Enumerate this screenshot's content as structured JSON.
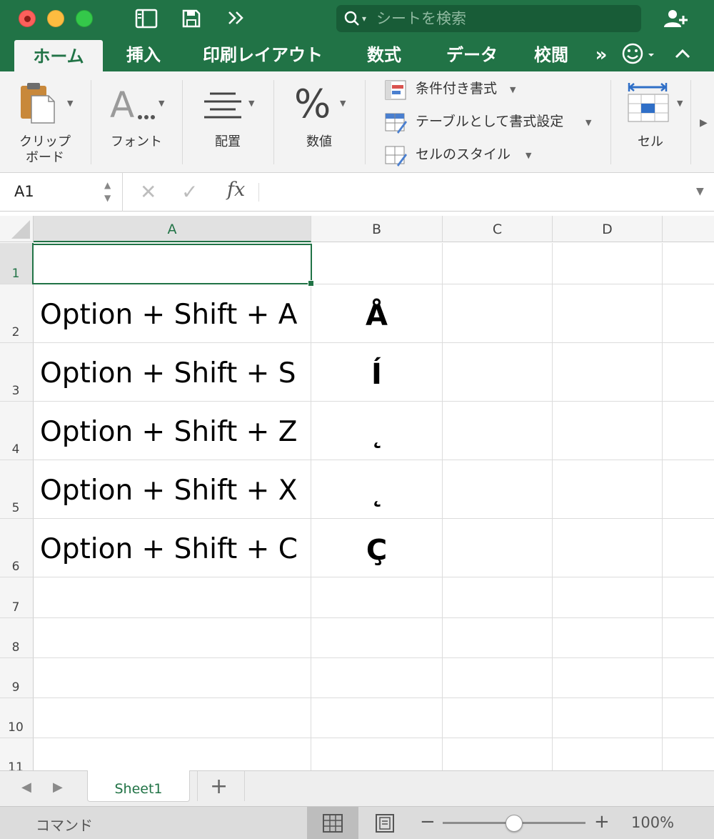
{
  "titlebar": {
    "search_placeholder": "シートを検索"
  },
  "ribbon_tabs": [
    {
      "label": "ホーム",
      "active": true
    },
    {
      "label": "挿入"
    },
    {
      "label": "印刷レイアウト"
    },
    {
      "label": "数式"
    },
    {
      "label": "データ"
    },
    {
      "label": "校閲"
    }
  ],
  "ribbon_tabs_overflow": "»",
  "ribbon": {
    "clipboard_line1": "クリップ",
    "clipboard_line2": "ボード",
    "font": "フォント",
    "alignment": "配置",
    "number": "数値",
    "number_symbol": "%",
    "conditional_formatting": "条件付き書式",
    "format_as_table": "テーブルとして書式設定",
    "cell_styles": "セルのスタイル",
    "cells": "セル"
  },
  "formula_bar": {
    "name_box": "A1",
    "fx": "fx",
    "formula": ""
  },
  "grid": {
    "columns": [
      "A",
      "B",
      "C",
      "D"
    ],
    "rows": [
      "1",
      "2",
      "3",
      "4",
      "5",
      "6",
      "7",
      "8",
      "9",
      "10",
      "11"
    ],
    "cells": [
      {
        "ref": "A1",
        "value": ""
      },
      {
        "ref": "A2",
        "value": "Option + Shift + A"
      },
      {
        "ref": "B2",
        "value": "Å"
      },
      {
        "ref": "A3",
        "value": "Option + Shift + S"
      },
      {
        "ref": "B3",
        "value": "Í"
      },
      {
        "ref": "A4",
        "value": "Option + Shift + Z"
      },
      {
        "ref": "B4",
        "value": "˛"
      },
      {
        "ref": "A5",
        "value": "Option + Shift + X"
      },
      {
        "ref": "B5",
        "value": "˛"
      },
      {
        "ref": "A6",
        "value": "Option + Shift + C"
      },
      {
        "ref": "B6",
        "value": "Ç"
      }
    ],
    "selected_cell": "A1"
  },
  "sheet_tabs": {
    "tabs": [
      "Sheet1"
    ],
    "active": "Sheet1",
    "add_label": "+"
  },
  "status_bar": {
    "mode": "コマンド",
    "zoom_minus": "−",
    "zoom_plus": "+",
    "zoom": "100%",
    "zoom_fraction": 0.5
  },
  "colors": {
    "accent": "#217346",
    "selection": "#217346"
  }
}
